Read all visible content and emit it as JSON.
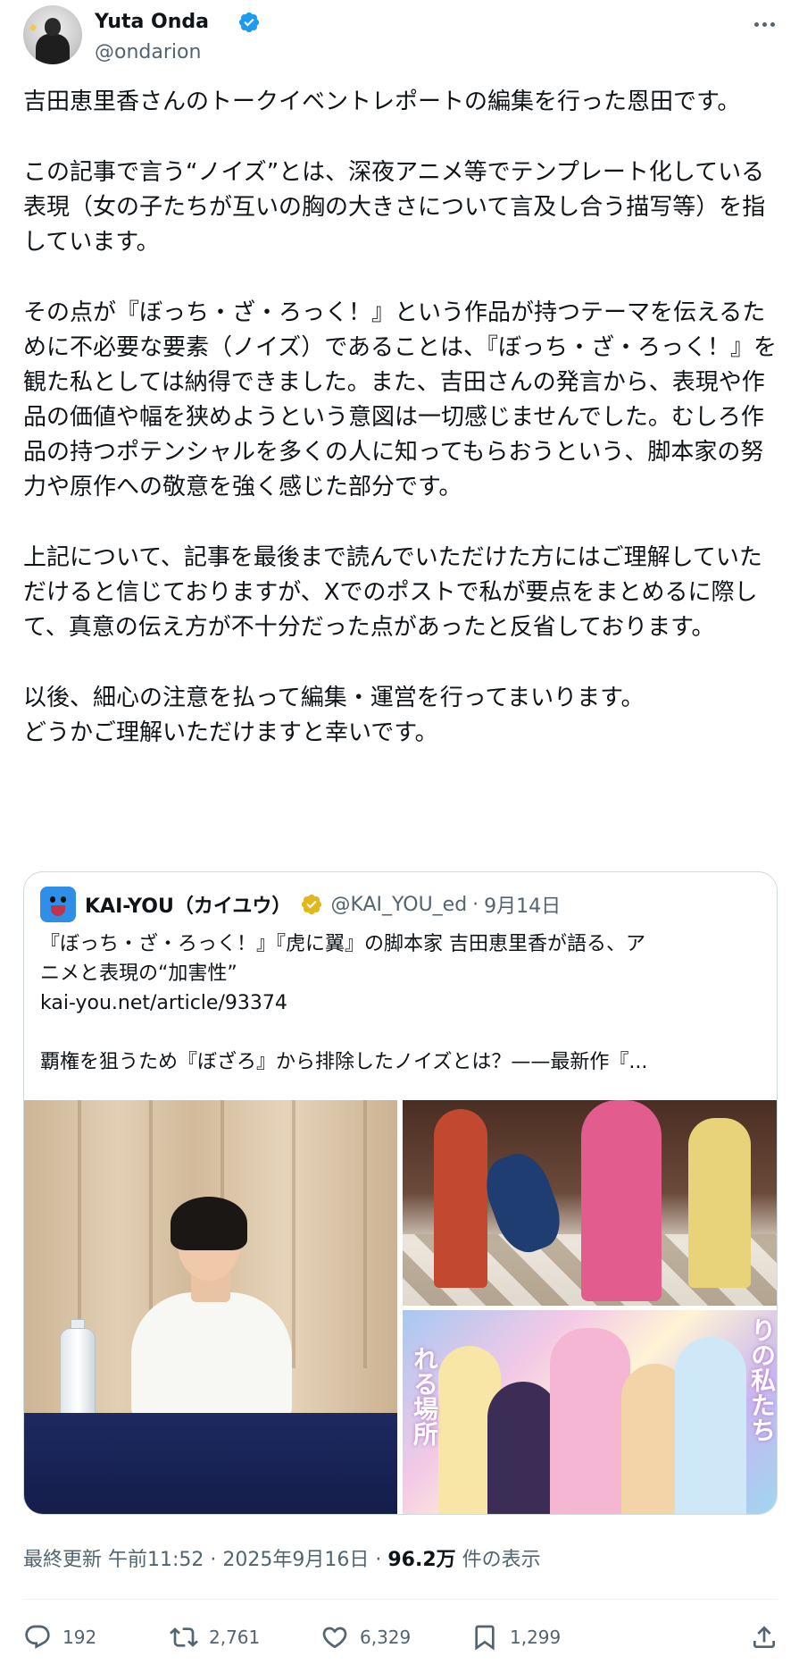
{
  "author": {
    "display_name": "Yuta Onda",
    "handle": "@ondarion",
    "verified": true
  },
  "tweet": {
    "paragraphs": [
      "吉田恵里香さんのトークイベントレポートの編集を行った恩田です。",
      "この記事で言う“ノイズ”とは、深夜アニメ等でテンプレート化している表現（女の子たちが互いの胸の大きさについて言及し合う描写等）を指しています。",
      "その点が『ぼっち・ざ・ろっく！』という作品が持つテーマを伝えるために不必要な要素（ノイズ）であることは、『ぼっち・ざ・ろっく！』を観た私としては納得できました。また、吉田さんの発言から、表現や作品の価値や幅を狭めようという意図は一切感じませんでした。むしろ作品の持つポテンシャルを多くの人に知ってもらおうという、脚本家の努力や原作への敬意を強く感じた部分です。",
      "上記について、記事を最後まで読んでいただけた方にはご理解していただけると信じておりますが、Xでのポストで私が要点をまとめるに際して、真意の伝え方が不十分だった点があったと反省しております。",
      "以後、細心の注意を払って編集・運営を行ってまいります。\nどうかご理解いただけますと幸いです。"
    ]
  },
  "quote": {
    "name": "KAI-YOU（カイユウ）",
    "handle": "@KAI_YOU_ed",
    "separator": "·",
    "date": "9月14日",
    "line1": "『ぼっち・ざ・ろっく！』『虎に翼』の脚本家 吉田恵里香が語る、ア",
    "line2": "ニメと表現の“加害性”",
    "line3": "kai-you.net/article/93374",
    "line4": "覇権を狙うため『ぼざろ』から排除したノイズとは？——最新作『...",
    "image_text": [
      "り",
      "の",
      "私",
      "た",
      "ち",
      "れ",
      "る",
      "場",
      "所"
    ]
  },
  "meta": {
    "prefix": "最終更新 午前11:52 · 2025年9月16日 · ",
    "views": "96.2万",
    "suffix": " 件の表示"
  },
  "actions": {
    "replies": "192",
    "reposts": "2,761",
    "likes": "6,329",
    "bookmarks": "1,299"
  },
  "colors": {
    "verified_blue": "#1d9bf0",
    "verified_gold": "#e2b719",
    "text_primary": "#0f1419",
    "text_secondary": "#536471"
  }
}
